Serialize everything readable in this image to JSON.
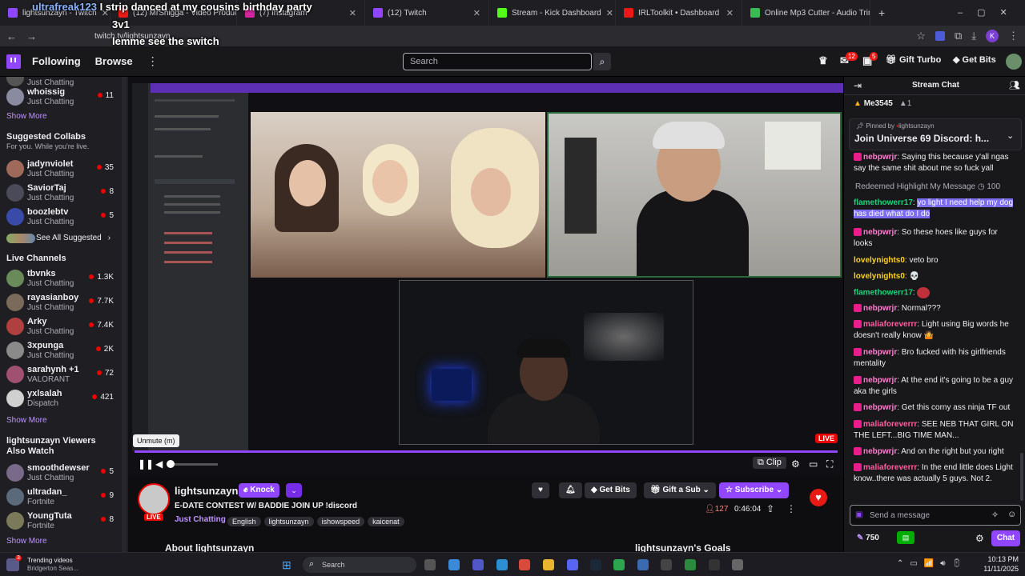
{
  "browser": {
    "tabs": [
      {
        "label": "lightsunzayn - Twitch",
        "color": "#9147ff"
      },
      {
        "label": "(12) MrShigga - Video Producti",
        "color": "#e91916"
      },
      {
        "label": "(7) Instagram",
        "color": "#d6249f"
      },
      {
        "label": "(12) Twitch",
        "color": "#9147ff"
      },
      {
        "label": "Stream - Kick Dashboard",
        "color": "#53fc18"
      },
      {
        "label": "IRLToolkit • Dashboard",
        "color": "#e91916"
      },
      {
        "label": "Online Mp3 Cutter - Audio Trim",
        "color": "#3cba54"
      }
    ],
    "url": "twitch.tv/lightsunzayn",
    "profile_initial": "K"
  },
  "overlay_chat": [
    {
      "user": "ultrafreak123",
      "text": "I strip danced at my cousins birthday party"
    },
    {
      "user": "",
      "text": "3v1"
    },
    {
      "user": "",
      "text": "lemme see the switch"
    }
  ],
  "topnav": {
    "following": "Following",
    "browse": "Browse",
    "search_placeholder": "Search",
    "notif_count": "12",
    "whisper_count": "5",
    "gift_turbo": "Gift Turbo",
    "get_bits": "Get Bits"
  },
  "sidebar": {
    "top_items": [
      {
        "name": "",
        "category": "Just Chatting",
        "count": ""
      },
      {
        "name": "whoissig",
        "category": "Just Chatting",
        "count": "11"
      }
    ],
    "show_more_1": "Show More",
    "collabs_title": "Suggested Collabs",
    "collabs_sub": "For you. While you're live.",
    "collabs": [
      {
        "name": "jadynviolet",
        "category": "Just Chatting",
        "count": "35"
      },
      {
        "name": "SaviorTaj",
        "category": "Just Chatting",
        "count": "8"
      },
      {
        "name": "boozlebtv",
        "category": "Just Chatting",
        "count": "5"
      }
    ],
    "see_all": "See All Suggested",
    "live_title": "Live Channels",
    "live": [
      {
        "name": "tbvnks",
        "category": "Just Chatting",
        "count": "1.3K"
      },
      {
        "name": "rayasianboy",
        "category": "Just Chatting",
        "count": "7.7K"
      },
      {
        "name": "Arky",
        "category": "Just Chatting",
        "count": "7.4K"
      },
      {
        "name": "3xpunga",
        "category": "Just Chatting",
        "count": "2K"
      },
      {
        "name": "sarahynh +1",
        "category": "VALORANT",
        "count": "72"
      },
      {
        "name": "yxlsalah",
        "category": "Dispatch",
        "count": "421"
      }
    ],
    "show_more_2": "Show More",
    "also_watch_title": "lightsunzayn Viewers Also Watch",
    "also_watch": [
      {
        "name": "smoothdewser",
        "category": "Just Chatting",
        "count": "5"
      },
      {
        "name": "ultradan_",
        "category": "Fortnite",
        "count": "9"
      },
      {
        "name": "YoungTuta",
        "category": "Fortnite",
        "count": "8"
      }
    ],
    "show_more_3": "Show More"
  },
  "player": {
    "tooltip": "Unmute (m)",
    "live_badge": "LIVE",
    "clip": "Clip",
    "progress": 0.0
  },
  "stream_info": {
    "channel": "lightsunzayn",
    "knock": "Knock",
    "title": "E-DATE CONTEST W/ BADDIE JOIN UP !discord",
    "category": "Just Chatting",
    "tags": [
      "English",
      "lightsunzayn",
      "ishowspeed",
      "kaicenat"
    ],
    "viewers": "127",
    "uptime": "0:46:04",
    "get_bits": "Get Bits",
    "gift_sub": "Gift a Sub",
    "subscribe": "Subscribe",
    "about": "About lightsunzayn",
    "goals": "lightsunzayn's Goals",
    "live": "LIVE"
  },
  "chat": {
    "header": "Stream Chat",
    "leader": "Me3545",
    "leader_count": "1",
    "pinned_by": "Pinned by",
    "pinned_user": "lightsunzayn",
    "pinned_text": "Join Universe 69 Discord: h...",
    "redeemed": "Redeemed Highlight My Message",
    "redeemed_cost": "100",
    "messages": [
      {
        "user": "nebpwrjr",
        "color": "#ff7fd0",
        "text": "Saying this because y'all ngas say the same shit about me so fuck yall"
      },
      {
        "user": "flamethowerr17",
        "color": "#1fd17a",
        "text": "yo light I need help my dog has died what do I do",
        "highlight": true
      },
      {
        "user": "nebpwrjr",
        "color": "#ff7fd0",
        "text": "So these hoes like guys for looks"
      },
      {
        "user": "lovelynights0",
        "color": "#ffd21f",
        "text": "veto bro"
      },
      {
        "user": "lovelynights0",
        "color": "#ffd21f",
        "text": "💀"
      },
      {
        "user": "flamethowerr17",
        "color": "#1fd17a",
        "text": ""
      },
      {
        "user": "nebpwrjr",
        "color": "#ff7fd0",
        "text": "Normal???"
      },
      {
        "user": "maliaforeverrr",
        "color": "#ff5fa2",
        "text": "Light using Big words he doesn't really know 🤷"
      },
      {
        "user": "nebpwrjr",
        "color": "#ff7fd0",
        "text": "Bro fucked with his girlfriends mentality"
      },
      {
        "user": "nebpwrjr",
        "color": "#ff7fd0",
        "text": "At the end it's going to be a guy aka the girls"
      },
      {
        "user": "nebpwrjr",
        "color": "#ff7fd0",
        "text": "Get this corny ass ninja TF out"
      },
      {
        "user": "maliaforeverrr",
        "color": "#ff5fa2",
        "text": "SEE NEB THAT GIRL ON THE LEFT...BIG TIME MAN..."
      },
      {
        "user": "nebpwrjr",
        "color": "#ff7fd0",
        "text": "And on the right but you right"
      },
      {
        "user": "maliaforeverrr",
        "color": "#ff5fa2",
        "text": "In the end little does Light know..there was actually 5 guys. Not 2."
      }
    ],
    "input_placeholder": "Send a message",
    "points": "750",
    "chat_button": "Chat"
  },
  "taskbar": {
    "trending": "Trending videos",
    "trending_sub": "Bridgerton Seas...",
    "search": "Search",
    "time": "10:13 PM",
    "date": "11/11/2025",
    "notif": "3"
  }
}
